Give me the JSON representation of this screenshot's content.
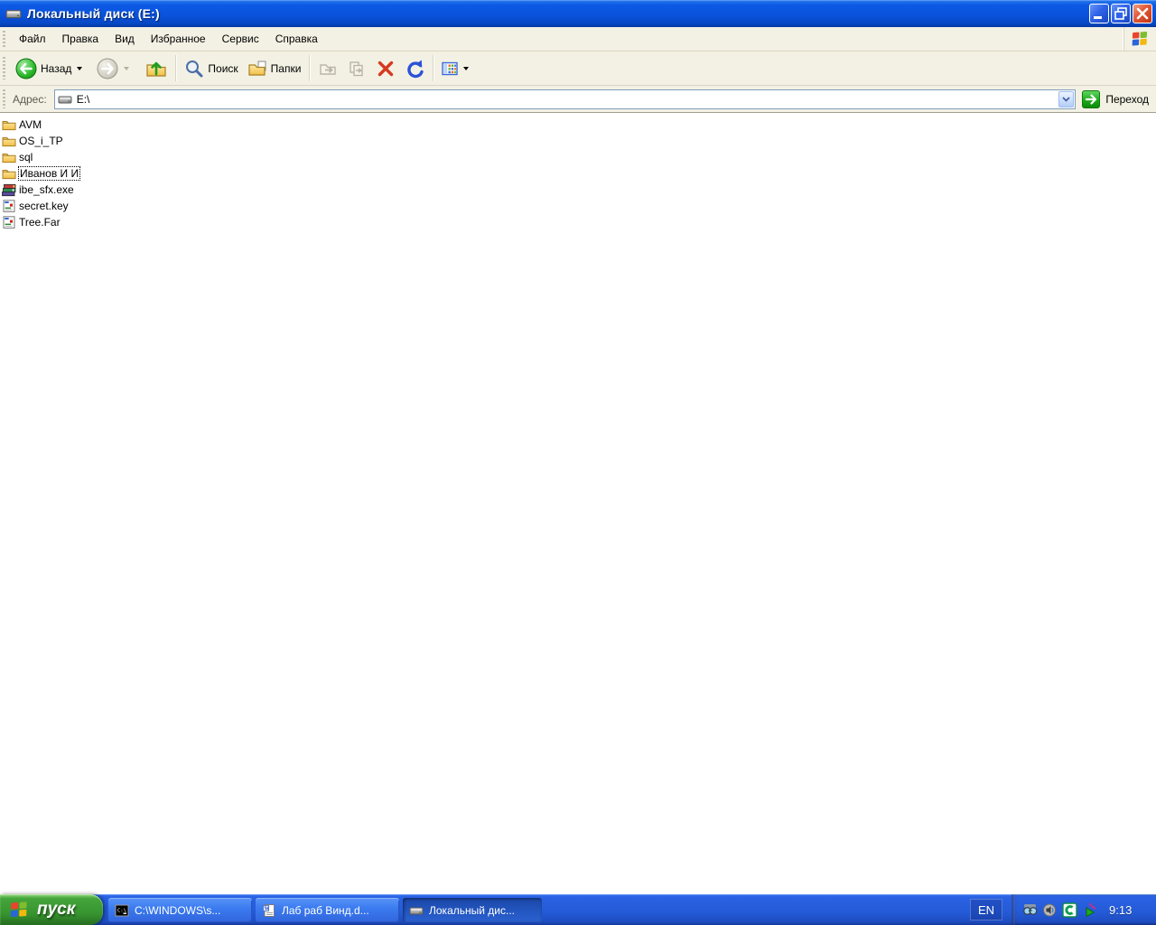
{
  "window": {
    "title": "Локальный диск (E:)"
  },
  "menu": {
    "items": [
      {
        "label": "Файл"
      },
      {
        "label": "Правка"
      },
      {
        "label": "Вид"
      },
      {
        "label": "Избранное"
      },
      {
        "label": "Сервис"
      },
      {
        "label": "Справка"
      }
    ]
  },
  "toolbar": {
    "back_label": "Назад",
    "search_label": "Поиск",
    "folders_label": "Папки",
    "icons": [
      "back-icon",
      "forward-icon",
      "up-icon",
      "search-icon",
      "folders-icon",
      "move-to-icon",
      "copy-to-icon",
      "delete-icon",
      "undo-icon",
      "views-icon"
    ]
  },
  "address": {
    "label": "Адрес:",
    "value": "E:\\",
    "go_label": "Переход",
    "icon": "disk-icon"
  },
  "files": {
    "view": "list",
    "items": [
      {
        "label": "AVM",
        "icon": "folder-icon",
        "focused": false
      },
      {
        "label": "OS_i_TP",
        "icon": "folder-icon",
        "focused": false
      },
      {
        "label": "sql",
        "icon": "folder-icon",
        "focused": false
      },
      {
        "label": "Иванов И И",
        "icon": "folder-icon",
        "focused": true
      },
      {
        "label": "ibe_sfx.exe",
        "icon": "rar-sfx-icon",
        "focused": false
      },
      {
        "label": "secret.key",
        "icon": "file-icon",
        "focused": false
      },
      {
        "label": "Tree.Far",
        "icon": "file-icon",
        "focused": false
      }
    ]
  },
  "taskbar": {
    "start_label": "пуск",
    "tasks": [
      {
        "label": "C:\\WINDOWS\\s...",
        "icon": "console-icon",
        "active": false
      },
      {
        "label": "Лаб раб Винд.d...",
        "icon": "word-icon",
        "active": false
      },
      {
        "label": "Локальный дис...",
        "icon": "disk-icon",
        "active": true
      }
    ],
    "language": "EN",
    "tray_icons": [
      "goggles-icon",
      "volume-icon",
      "green-app-icon",
      "launcher-icon"
    ],
    "clock": "9:13"
  },
  "colors": {
    "titlebar_blue": "#0a52dc",
    "taskbar_blue": "#245ad6",
    "start_green": "#379330",
    "face": "#f3f1e4",
    "close_red": "#e25634",
    "go_green": "#18a818",
    "combo_border": "#7f9db9"
  }
}
